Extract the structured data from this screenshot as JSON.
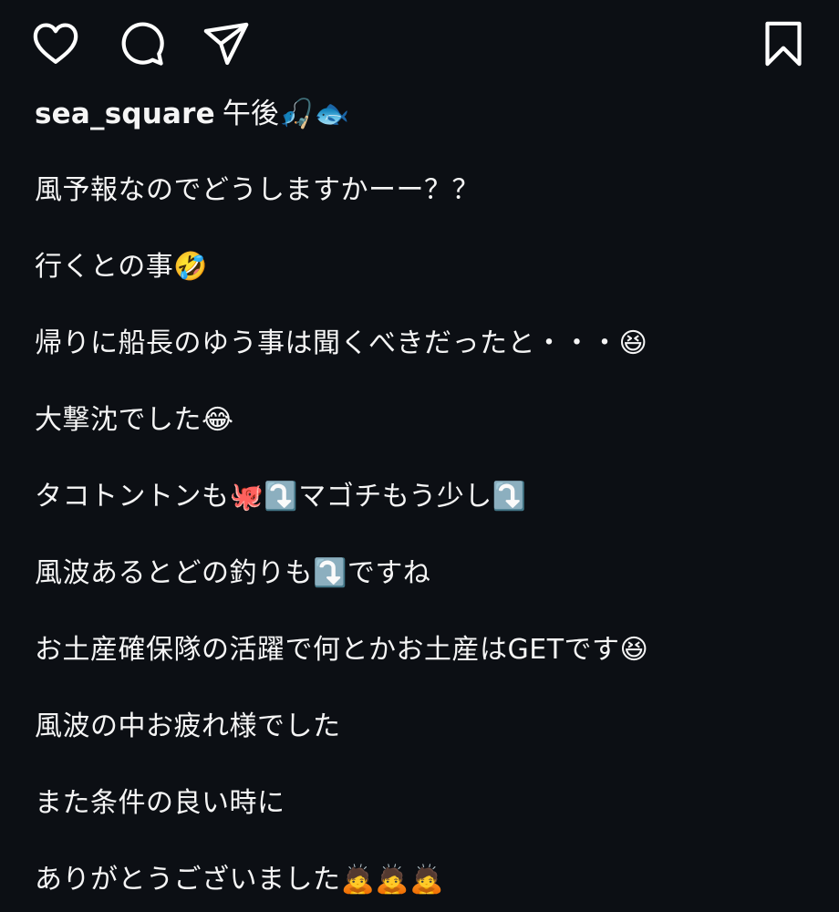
{
  "post": {
    "username": "sea_square",
    "time": "午後🎣🐟"
  },
  "caption": {
    "lines": [
      "風予報なのでどうしますかーー？？",
      "行くとの事🤣",
      "帰りに船長のゆう事は聞くべきだったと・・・😆",
      "大撃沈でした😂",
      "タコトントンも🐙⤵️マゴチもう少し⤵️",
      "風波あるとどの釣りも⤵️ですね",
      "お土産確保隊の活躍で何とかお土産はGETです😆",
      "風波の中お疲れ様でした",
      "また条件の良い時に",
      "ありがとうございました🙇🙇🙇"
    ]
  },
  "actions": {
    "like_icon": "heart-icon",
    "comment_icon": "comment-bubble-icon",
    "share_icon": "paper-plane-icon",
    "save_icon": "bookmark-icon"
  },
  "colors": {
    "background": "#0c0f14",
    "text": "#f5f5f5",
    "icon": "#ffffff"
  }
}
